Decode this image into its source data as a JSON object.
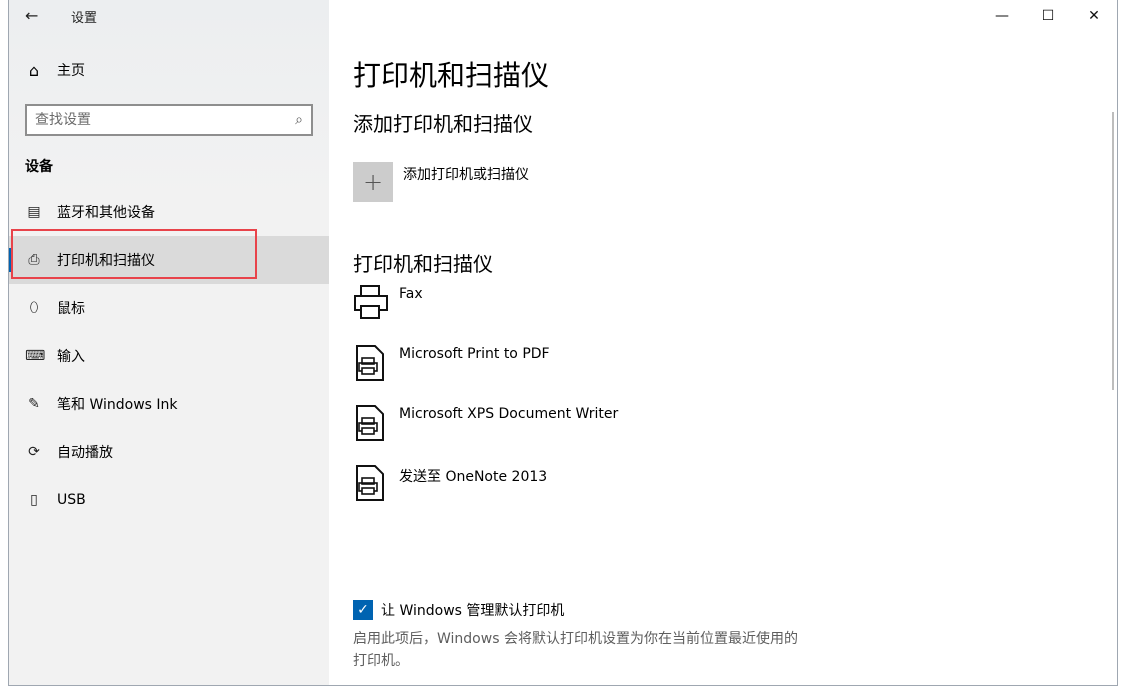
{
  "window": {
    "app_title": "设置",
    "back_icon": "←",
    "controls": {
      "minimize": "—",
      "maximize": "☐",
      "close": "✕"
    }
  },
  "sidebar": {
    "home_label": "主页",
    "home_icon": "⌂",
    "search_placeholder": "查找设置",
    "search_icon": "⌕",
    "section_header": "设备",
    "items": [
      {
        "label": "蓝牙和其他设备",
        "icon": "▤",
        "selected": false
      },
      {
        "label": "打印机和扫描仪",
        "icon": "⎙",
        "selected": true
      },
      {
        "label": "鼠标",
        "icon": "⬯",
        "selected": false
      },
      {
        "label": "输入",
        "icon": "⌨",
        "selected": false
      },
      {
        "label": "笔和 Windows Ink",
        "icon": "✎",
        "selected": false
      },
      {
        "label": "自动播放",
        "icon": "⟳",
        "selected": false
      },
      {
        "label": "USB",
        "icon": "▯",
        "selected": false
      }
    ]
  },
  "main": {
    "page_title": "打印机和扫描仪",
    "add_section_title": "添加打印机和扫描仪",
    "add_button_icon": "+",
    "add_button_label": "添加打印机或扫描仪",
    "list_section_title": "打印机和扫描仪",
    "printers": [
      {
        "name": "Fax",
        "icon": "fax-printer-icon"
      },
      {
        "name": "Microsoft Print to PDF",
        "icon": "document-printer-icon"
      },
      {
        "name": "Microsoft XPS Document Writer",
        "icon": "document-printer-icon"
      },
      {
        "name": "发送至 OneNote 2013",
        "icon": "document-printer-icon"
      }
    ],
    "default_printer_checkbox": {
      "checked": true,
      "check_glyph": "✓",
      "label": "让 Windows 管理默认打印机",
      "description": "启用此项后，Windows 会将默认打印机设置为你在当前位置最近使用的打印机。"
    }
  },
  "colors": {
    "accent": "#0063b1",
    "highlight_border": "#e8434a",
    "sidebar_bg": "#f2f2f2",
    "selected_bg": "#dadada"
  }
}
